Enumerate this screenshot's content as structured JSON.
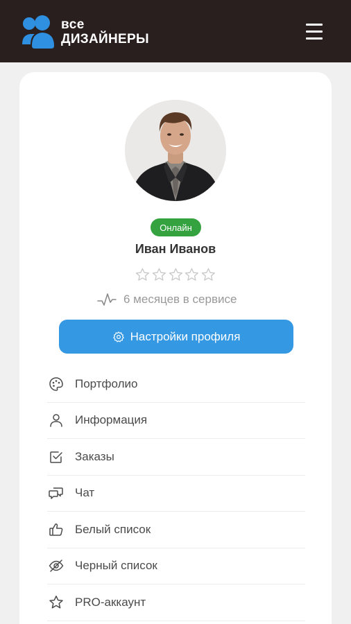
{
  "header": {
    "logo_line1": "все",
    "logo_line2": "дизайнеры",
    "menu_icon": "hamburger-icon"
  },
  "profile": {
    "status": "Онлайн",
    "name": "Иван Иванов",
    "rating_stars_filled": 0,
    "rating_stars_total": 5,
    "tenure": "6 месяцев в сервисе",
    "settings_button": "Настройки профиля"
  },
  "menu": [
    {
      "icon": "palette-icon",
      "label": "Портфолио"
    },
    {
      "icon": "user-icon",
      "label": "Информация"
    },
    {
      "icon": "checkbox-icon",
      "label": "Заказы"
    },
    {
      "icon": "chat-icon",
      "label": "Чат"
    },
    {
      "icon": "thumbs-up-icon",
      "label": "Белый список"
    },
    {
      "icon": "eye-off-icon",
      "label": "Черный список"
    },
    {
      "icon": "star-icon",
      "label": "PRO-аккаунт"
    }
  ],
  "colors": {
    "header_bg": "#2a1f1f",
    "logo_accent": "#2f8fe0",
    "online_badge": "#35a240",
    "primary_button": "#3498e3",
    "page_bg": "#f1f0f1"
  }
}
